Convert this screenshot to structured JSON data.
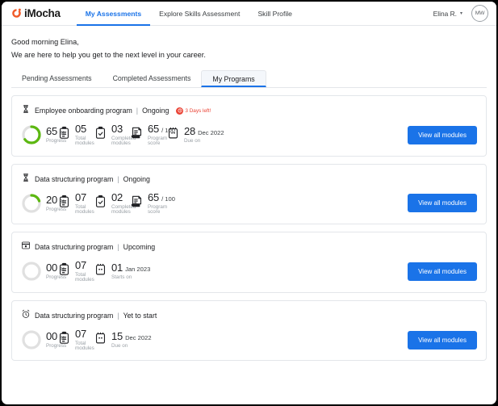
{
  "brand": {
    "name": "iMocha",
    "logo_color": "#f05a28"
  },
  "nav": {
    "links": [
      {
        "label": "My Assessments",
        "active": true
      },
      {
        "label": "Explore Skills Assessment",
        "active": false
      },
      {
        "label": "Skill Profile",
        "active": false
      }
    ],
    "user_name": "Elina R.",
    "user_caret": "▾",
    "avatar_initials": "MW"
  },
  "greeting": {
    "line1": "Good morning Elina,",
    "line2": "We are here to help you get to the next level in your career."
  },
  "tabs": [
    {
      "label": "Pending Assessments",
      "active": false
    },
    {
      "label": "Completed Assessments",
      "active": false
    },
    {
      "label": "My Programs",
      "active": true
    }
  ],
  "theme": {
    "accent": "#1a73e8",
    "progress_green": "#5cb811",
    "track_gray": "#e0e0e0",
    "alert_red": "#ea4335",
    "muted": "#9aa0a6"
  },
  "button_label": "View all modules",
  "separator": "|",
  "cards": [
    {
      "icon": "hourglass-icon",
      "title": "Employee onboarding program",
      "status": "Ongoing",
      "badge": {
        "text": "3 Days left!",
        "icon": "clock-alert-icon"
      },
      "progress": {
        "value": "65",
        "unit": "%",
        "label": "Progress",
        "percent": 65
      },
      "stats": [
        {
          "icon": "clipboard-list-icon",
          "value": "05",
          "unit": "",
          "label": "Total modules"
        },
        {
          "icon": "clipboard-check-icon",
          "value": "03",
          "unit": "",
          "label": "Completed modules"
        },
        {
          "icon": "score-document-icon",
          "value": "65",
          "unit": "/ 100",
          "label": "Program score"
        },
        {
          "icon": "calendar-icon",
          "value": "28",
          "unit": "Dec 2022",
          "label": "Due on"
        }
      ]
    },
    {
      "icon": "hourglass-icon",
      "title": "Data structuring program",
      "status": "Ongoing",
      "badge": null,
      "progress": {
        "value": "20",
        "unit": "%",
        "label": "Progress",
        "percent": 20
      },
      "stats": [
        {
          "icon": "clipboard-list-icon",
          "value": "07",
          "unit": "",
          "label": "Total modules"
        },
        {
          "icon": "clipboard-check-icon",
          "value": "02",
          "unit": "",
          "label": "Completed modules"
        },
        {
          "icon": "score-document-icon",
          "value": "65",
          "unit": "/ 100",
          "label": "Program score"
        }
      ]
    },
    {
      "icon": "upcoming-calendar-icon",
      "title": "Data structuring program",
      "status": "Upcoming",
      "badge": null,
      "progress": {
        "value": "00",
        "unit": "%",
        "label": "Progress",
        "percent": 0
      },
      "stats": [
        {
          "icon": "clipboard-list-icon",
          "value": "07",
          "unit": "",
          "label": "Total modules"
        },
        {
          "icon": "calendar-icon",
          "value": "01",
          "unit": "Jan 2023",
          "label": "Starts on"
        }
      ]
    },
    {
      "icon": "alarm-clock-icon",
      "title": "Data structuring program",
      "status": "Yet to start",
      "badge": null,
      "progress": {
        "value": "00",
        "unit": "%",
        "label": "Progress",
        "percent": 0
      },
      "stats": [
        {
          "icon": "clipboard-list-icon",
          "value": "07",
          "unit": "",
          "label": "Total modules"
        },
        {
          "icon": "calendar-icon",
          "value": "15",
          "unit": "Dec 2022",
          "label": "Due on"
        }
      ]
    }
  ]
}
